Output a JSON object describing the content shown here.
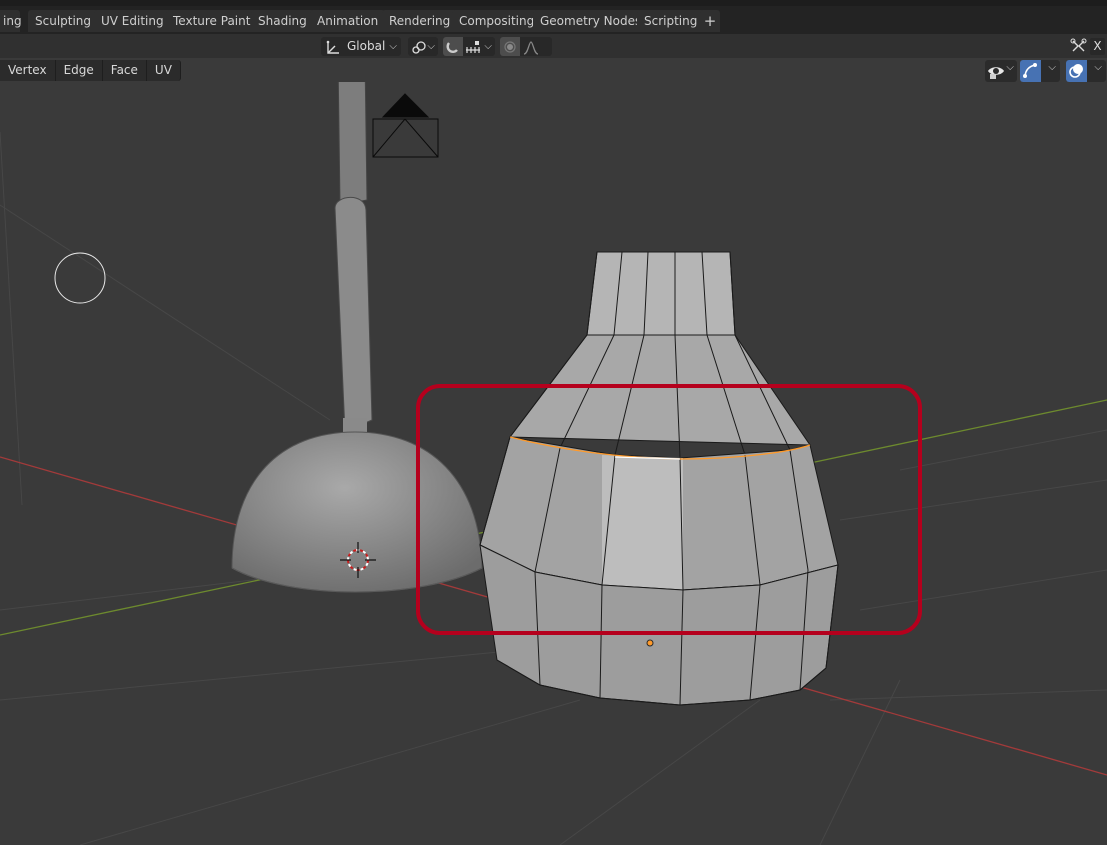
{
  "workspace_tabs": [
    {
      "label": "ing"
    },
    {
      "label": "Sculpting"
    },
    {
      "label": "UV Editing"
    },
    {
      "label": "Texture Paint"
    },
    {
      "label": "Shading"
    },
    {
      "label": "Animation"
    },
    {
      "label": "Rendering"
    },
    {
      "label": "Compositing"
    },
    {
      "label": "Geometry Nodes"
    },
    {
      "label": "Scripting"
    }
  ],
  "add_workspace_label": "+",
  "header": {
    "transform_orientation": "Global",
    "close_label": "X",
    "icons": [
      "transform-orientation-icon",
      "pivot-point-icon",
      "snap-magnet-icon",
      "snap-increment-icon",
      "proportional-edit-icon",
      "falloff-curve-icon",
      "gizmo-icon"
    ]
  },
  "select_modes": [
    "Vertex",
    "Edge",
    "Face",
    "UV"
  ],
  "viewport_controls": {
    "icons": [
      "visibility-eye-icon",
      "gizmo-toggle-icon",
      "overlay-toggle-icon"
    ]
  },
  "colors": {
    "background": "#3a3a3a",
    "selected_edge": "#ff9a2a",
    "highlight_box": "#b5001d",
    "x_axis": "#a33a3a",
    "y_axis": "#6d8a2e",
    "active_blue": "#4772b3"
  }
}
